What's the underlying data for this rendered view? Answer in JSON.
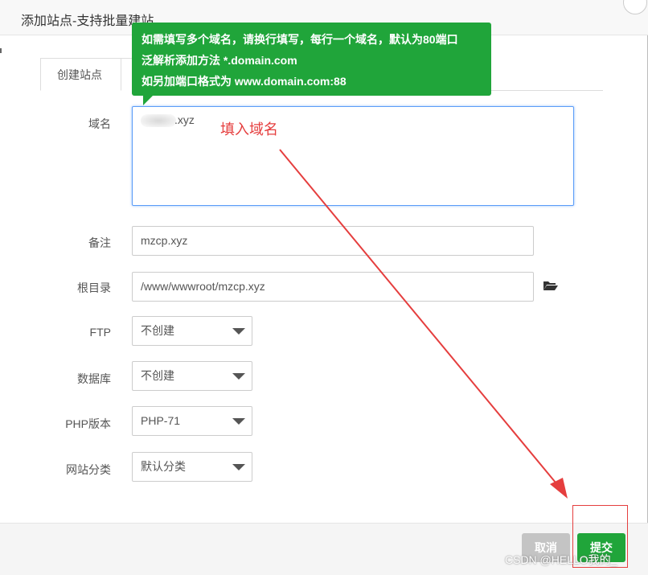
{
  "dialog": {
    "title": "添加站点-支持批量建站"
  },
  "tabs": [
    {
      "label": "创建站点"
    },
    {
      "label": ""
    }
  ],
  "tooltip": {
    "lines": [
      "如需填写多个域名，请换行填写，每行一个域名，默认为80端口",
      "泛解析添加方法 *.domain.com",
      "如另加端口格式为 www.domain.com:88"
    ],
    "color": "#20a53a"
  },
  "form": {
    "domain": {
      "label": "域名",
      "value_suffix": ".xyz"
    },
    "remark": {
      "label": "备注",
      "value": "mzcp.xyz"
    },
    "root": {
      "label": "根目录",
      "value": "/www/wwwroot/mzcp.xyz",
      "icon": "folder-open-icon"
    },
    "ftp": {
      "label": "FTP",
      "value": "不创建"
    },
    "database": {
      "label": "数据库",
      "value": "不创建"
    },
    "php": {
      "label": "PHP版本",
      "value": "PHP-71"
    },
    "category": {
      "label": "网站分类",
      "value": "默认分类"
    }
  },
  "annotation": {
    "text": "填入域名",
    "color": "#e53e3e"
  },
  "footer": {
    "cancel_label": "取消",
    "submit_label": "提交"
  },
  "watermark": "CSDN @HELLO我的_"
}
